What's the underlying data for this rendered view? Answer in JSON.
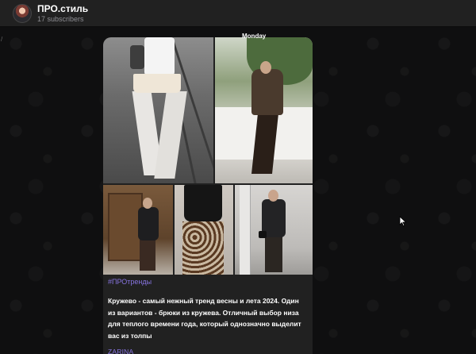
{
  "header": {
    "channel_name": "ПРО.стиль",
    "subscribers": "17 subscribers"
  },
  "chat": {
    "date_label": "Monday",
    "left_edge_mark": "/"
  },
  "message": {
    "hashtag": "#ПРОтренды",
    "text": "Кружево - самый нежный тренд весны и лета 2024. Один из вариантов - брюки из кружева. Отличный выбор низа для теплого времени года, который однозначно выделит вас из толпы",
    "signature": "ZARINA",
    "photos_count": 5
  },
  "colors": {
    "background": "#0f0f10",
    "header": "#212121",
    "bubble": "#212121",
    "accent": "#8774e1",
    "text_primary": "#ffffff",
    "text_secondary": "#8e8e93"
  },
  "icons": {
    "avatar": "channel-avatar",
    "cursor": "mouse-pointer-icon"
  }
}
